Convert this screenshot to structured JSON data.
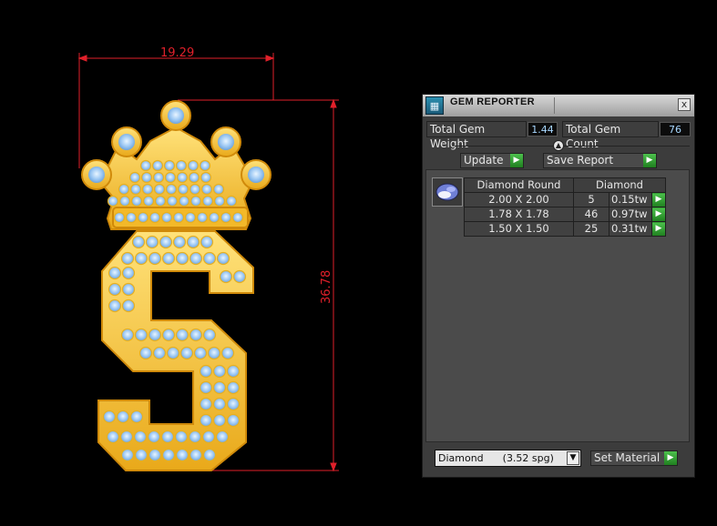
{
  "canvas": {
    "width_dimension": "19.29",
    "height_dimension": "36.78",
    "colors": {
      "gold": "#f6c333",
      "gem": "#9cc8f4",
      "dimension_line": "#e0202a"
    }
  },
  "panel": {
    "title": "GEM REPORTER",
    "close_label": "x",
    "total_gem_weight_label": "Total Gem Weight",
    "total_gem_weight_value": "1.44",
    "total_gem_count_label": "Total Gem Count",
    "total_gem_count_value": "76",
    "update_label": "Update",
    "save_report_label": "Save Report",
    "table": {
      "headers": [
        "Diamond Round",
        "Diamond"
      ],
      "rows": [
        {
          "size": "2.00 X 2.00",
          "count": "5",
          "weight": "0.15tw"
        },
        {
          "size": "1.78 X 1.78",
          "count": "46",
          "weight": "0.97tw"
        },
        {
          "size": "1.50 X 1.50",
          "count": "25",
          "weight": "0.31tw"
        }
      ]
    },
    "material_value": "Diamond      (3.52 spg)",
    "set_material_label": "Set Material"
  }
}
